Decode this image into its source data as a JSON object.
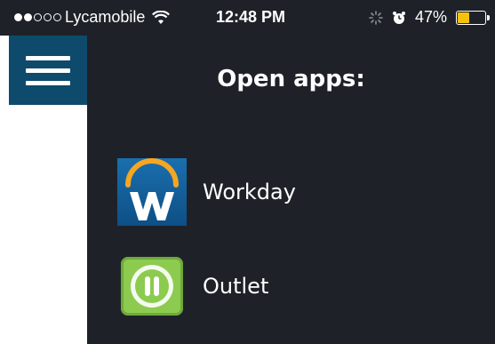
{
  "status_bar": {
    "signal_dots_filled": 2,
    "signal_dots_total": 5,
    "carrier": "Lycamobile",
    "wifi_icon": "wifi-icon",
    "time": "12:48 PM",
    "loading_icon": "spinner-icon",
    "alarm_icon": "alarm-icon",
    "battery_text": "47%",
    "battery_level": 0.47,
    "battery_color": "#f4c20d"
  },
  "menu": {
    "icon": "hamburger-menu-icon",
    "color": "#0e4a6c"
  },
  "panel": {
    "title": "Open apps:",
    "background": "#1e2228",
    "apps": [
      {
        "label": "Workday",
        "icon": "workday-logo-icon"
      },
      {
        "label": "Outlet",
        "icon": "outlet-app-icon"
      }
    ]
  }
}
